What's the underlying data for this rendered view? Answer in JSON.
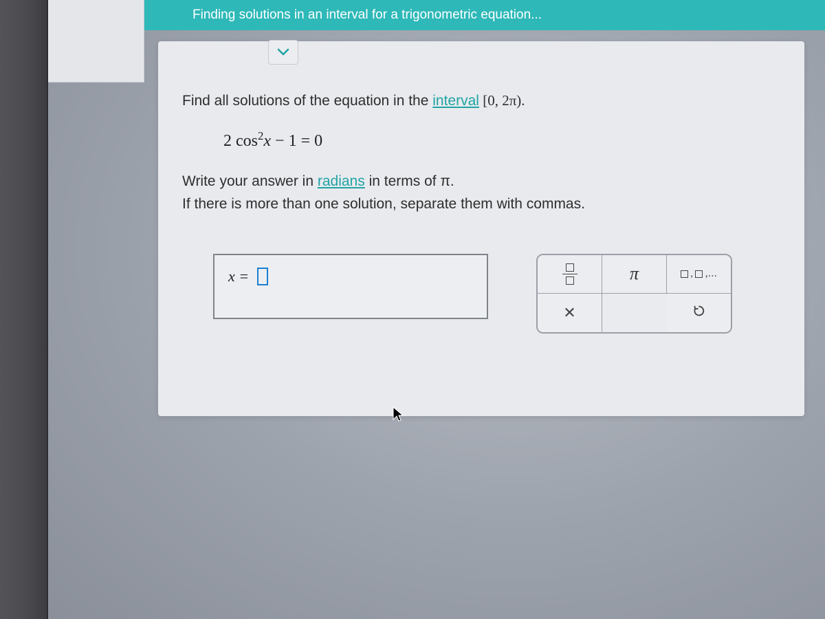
{
  "header": {
    "title": "Finding solutions in an interval for a trigonometric equation..."
  },
  "problem": {
    "instruction_prefix": "Find all solutions of the equation in the ",
    "interval_word": "interval",
    "interval_notation": " [0, 2π).",
    "equation": "2 cos²x − 1 = 0",
    "radians_prefix": "Write your answer in ",
    "radians_word": "radians",
    "radians_suffix": " in terms of π.",
    "multi_solution_note": "If there is more than one solution, separate them with commas."
  },
  "answer": {
    "label": "x ="
  },
  "toolbox": {
    "fraction_title": "fraction",
    "pi_label": "π",
    "list_label": "□,□,...",
    "clear_label": "×",
    "reset_label": "↺"
  }
}
